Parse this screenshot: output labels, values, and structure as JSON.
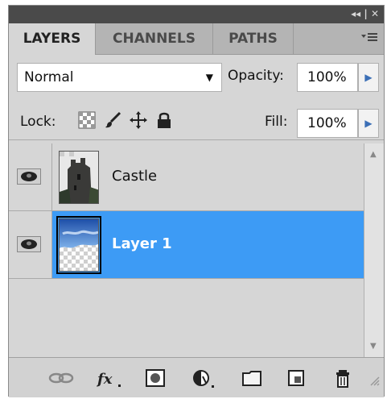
{
  "panel": {
    "titlebar_controls": "◂◂ | ✕"
  },
  "tabs": [
    {
      "label": "LAYERS",
      "active": true
    },
    {
      "label": "CHANNELS",
      "active": false
    },
    {
      "label": "PATHS",
      "active": false
    }
  ],
  "tab_menu_icon": "panel-menu-icon",
  "blend": {
    "mode": "Normal",
    "opacity_label": "Opacity:",
    "opacity_value": "100%",
    "lock_label": "Lock:",
    "fill_label": "Fill:",
    "fill_value": "100%"
  },
  "lock_icons": [
    "lock-transparent-icon",
    "lock-paint-brush-icon",
    "lock-position-icon",
    "lock-all-icon"
  ],
  "layers": [
    {
      "name": "Castle",
      "visible": true,
      "selected": false,
      "thumbnail": "castle-thumbnail"
    },
    {
      "name": "Layer 1",
      "visible": true,
      "selected": true,
      "thumbnail": "sky-thumbnail"
    }
  ],
  "bottom_icons": [
    "link-layers-icon",
    "fx-icon",
    "add-mask-icon",
    "adjustment-layer-icon",
    "new-group-icon",
    "new-layer-icon",
    "trash-icon"
  ],
  "colors": {
    "selection": "#3d9bf5",
    "panel_bg": "#d6d6d6",
    "titlebar": "#4a4a4a"
  }
}
